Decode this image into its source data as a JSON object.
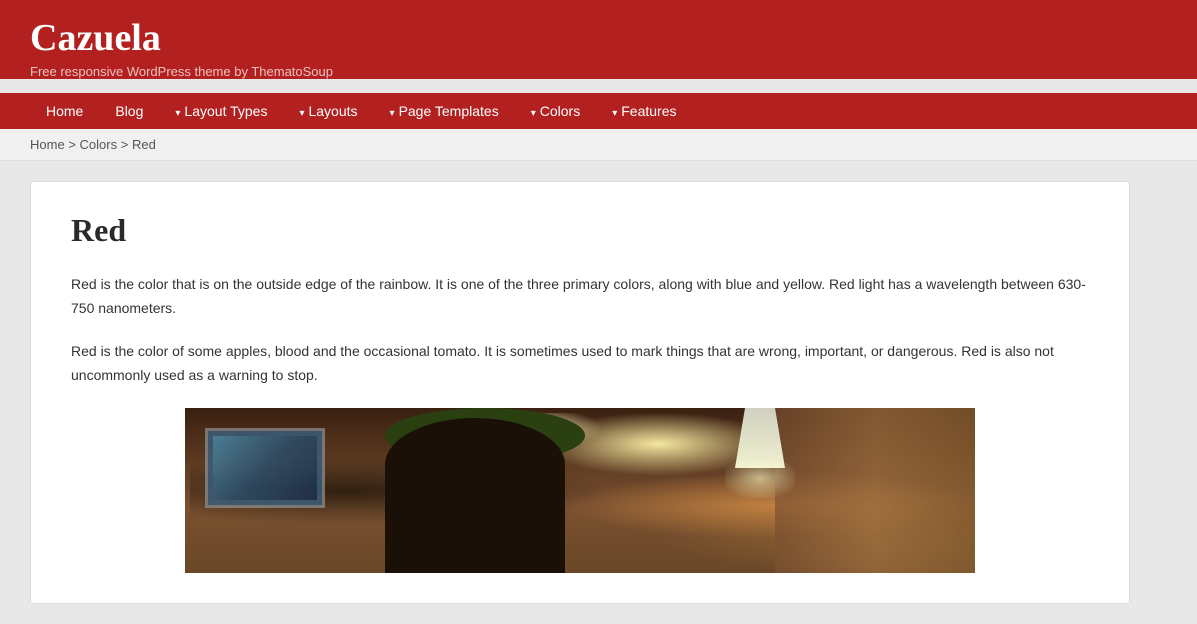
{
  "site": {
    "title": "Cazuela",
    "tagline": "Free responsive WordPress theme by ThematoSoup"
  },
  "nav": {
    "items": [
      {
        "label": "Home",
        "has_dropdown": false
      },
      {
        "label": "Blog",
        "has_dropdown": false
      },
      {
        "label": "Layout Types",
        "has_dropdown": true
      },
      {
        "label": "Layouts",
        "has_dropdown": true
      },
      {
        "label": "Page Templates",
        "has_dropdown": true
      },
      {
        "label": "Colors",
        "has_dropdown": true
      },
      {
        "label": "Features",
        "has_dropdown": true
      }
    ]
  },
  "breadcrumb": {
    "items": [
      {
        "label": "Home",
        "href": "#"
      },
      {
        "label": "Colors",
        "href": "#"
      },
      {
        "label": "Red",
        "href": "#"
      }
    ],
    "separator": ">"
  },
  "page": {
    "title": "Red",
    "paragraph1": "Red is the color that is on the outside edge of the rainbow. It is one of the three primary colors, along with blue and yellow. Red light has a wavelength between 630-750 nanometers.",
    "paragraph2": "Red is the color of some apples, blood and the occasional tomato. It is sometimes used to mark things that are wrong, important, or dangerous. Red is also not uncommonly used as a warning to stop."
  },
  "colors": {
    "header_bg": "#b32020",
    "nav_bg": "#b32020",
    "breadcrumb_bg": "#f0f0f0"
  }
}
